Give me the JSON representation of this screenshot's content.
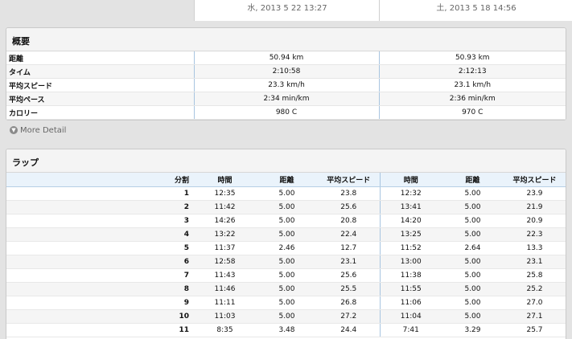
{
  "header": {
    "col1": "水, 2013 5 22 13:27",
    "col2": "土, 2013 5 18 14:56"
  },
  "summary": {
    "title": "概要",
    "rows": [
      {
        "label": "距離",
        "v1": "50.94 km",
        "v2": "50.93 km"
      },
      {
        "label": "タイム",
        "v1": "2:10:58",
        "v2": "2:12:13"
      },
      {
        "label": "平均スピード",
        "v1": "23.3 km/h",
        "v2": "23.1 km/h"
      },
      {
        "label": "平均ペース",
        "v1": "2:34 min/km",
        "v2": "2:36 min/km"
      },
      {
        "label": "カロリー",
        "v1": "980 C",
        "v2": "970 C"
      }
    ]
  },
  "more_detail": {
    "label": "More Detail",
    "icon": "chevron-down-icon"
  },
  "laps": {
    "title": "ラップ",
    "headers": {
      "lap": "分割",
      "time": "時間",
      "distance": "距離",
      "avg_speed": "平均スピード"
    },
    "rows": [
      {
        "n": "1",
        "t1": "12:35",
        "d1": "5.00",
        "s1": "23.8",
        "t2": "12:32",
        "d2": "5.00",
        "s2": "23.9"
      },
      {
        "n": "2",
        "t1": "11:42",
        "d1": "5.00",
        "s1": "25.6",
        "t2": "13:41",
        "d2": "5.00",
        "s2": "21.9"
      },
      {
        "n": "3",
        "t1": "14:26",
        "d1": "5.00",
        "s1": "20.8",
        "t2": "14:20",
        "d2": "5.00",
        "s2": "20.9"
      },
      {
        "n": "4",
        "t1": "13:22",
        "d1": "5.00",
        "s1": "22.4",
        "t2": "13:25",
        "d2": "5.00",
        "s2": "22.3"
      },
      {
        "n": "5",
        "t1": "11:37",
        "d1": "2.46",
        "s1": "12.7",
        "t2": "11:52",
        "d2": "2.64",
        "s2": "13.3"
      },
      {
        "n": "6",
        "t1": "12:58",
        "d1": "5.00",
        "s1": "23.1",
        "t2": "13:00",
        "d2": "5.00",
        "s2": "23.1"
      },
      {
        "n": "7",
        "t1": "11:43",
        "d1": "5.00",
        "s1": "25.6",
        "t2": "11:38",
        "d2": "5.00",
        "s2": "25.8"
      },
      {
        "n": "8",
        "t1": "11:46",
        "d1": "5.00",
        "s1": "25.5",
        "t2": "11:55",
        "d2": "5.00",
        "s2": "25.2"
      },
      {
        "n": "9",
        "t1": "11:11",
        "d1": "5.00",
        "s1": "26.8",
        "t2": "11:06",
        "d2": "5.00",
        "s2": "27.0"
      },
      {
        "n": "10",
        "t1": "11:03",
        "d1": "5.00",
        "s1": "27.2",
        "t2": "11:04",
        "d2": "5.00",
        "s2": "27.1"
      },
      {
        "n": "11",
        "t1": "8:35",
        "d1": "3.48",
        "s1": "24.4",
        "t2": "7:41",
        "d2": "3.29",
        "s2": "25.7"
      }
    ]
  }
}
